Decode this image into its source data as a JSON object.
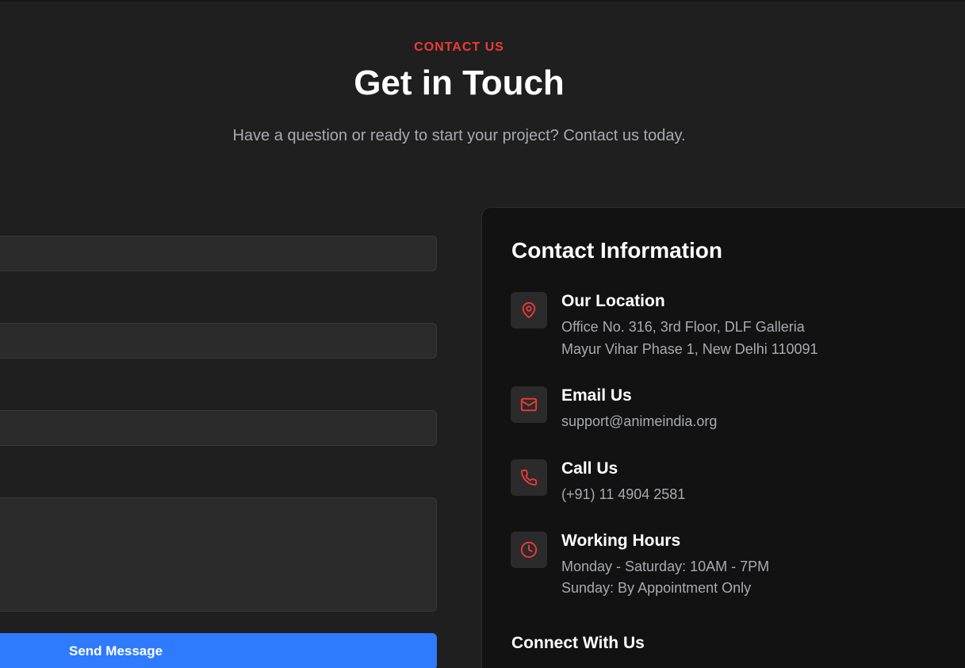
{
  "header": {
    "eyebrow": "CONTACT US",
    "title": "Get in Touch",
    "subtitle": "Have a question or ready to start your project? Contact us today."
  },
  "form": {
    "send_label": "Send Message"
  },
  "info": {
    "title": "Contact Information",
    "location": {
      "heading": "Our Location",
      "line1": "Office No. 316, 3rd Floor, DLF Galleria",
      "line2": "Mayur Vihar Phase 1, New Delhi 110091",
      "icon": "map-pin-icon"
    },
    "email": {
      "heading": "Email Us",
      "line1": "support@animeindia.org",
      "icon": "mail-icon"
    },
    "call": {
      "heading": "Call Us",
      "line1": "(+91) 11 4904 2581",
      "icon": "phone-icon"
    },
    "hours": {
      "heading": "Working Hours",
      "line1": "Monday - Saturday: 10AM - 7PM",
      "line2": "Sunday: By Appointment Only",
      "icon": "clock-icon"
    },
    "connect_title": "Connect With Us"
  },
  "colors": {
    "accent": "#ef3b36",
    "button": "#2f7bff",
    "background": "#1f1f1f",
    "panel": "#121212"
  }
}
